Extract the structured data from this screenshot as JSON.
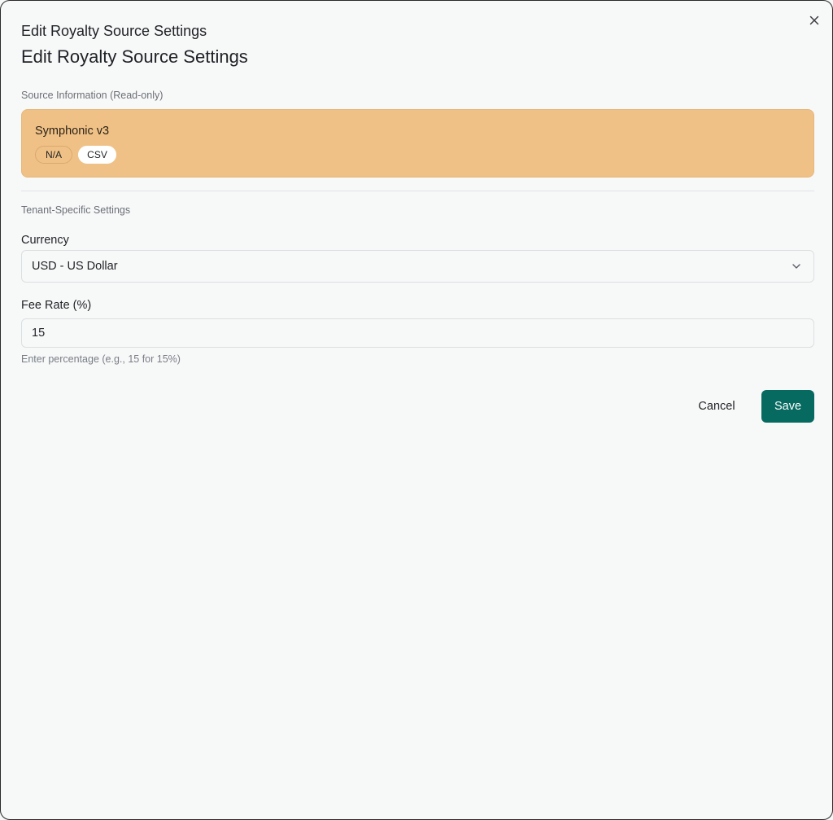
{
  "dialog": {
    "title_small": "Edit Royalty Source Settings",
    "title_large": "Edit Royalty Source Settings",
    "close_icon": "close-icon"
  },
  "source_info": {
    "section_label": "Source Information (Read-only)",
    "name": "Symphonic v3",
    "badges": [
      "N/A",
      "CSV"
    ],
    "card_color": "#f0c186"
  },
  "tenant_settings": {
    "section_label": "Tenant-Specific Settings",
    "currency": {
      "label": "Currency",
      "selected": "USD - US Dollar",
      "icon": "chevron-down-icon"
    },
    "fee_rate": {
      "label": "Fee Rate (%)",
      "value": "15",
      "hint": "Enter percentage (e.g., 15 for 15%)"
    }
  },
  "actions": {
    "cancel_label": "Cancel",
    "save_label": "Save",
    "save_color": "#066a60"
  }
}
